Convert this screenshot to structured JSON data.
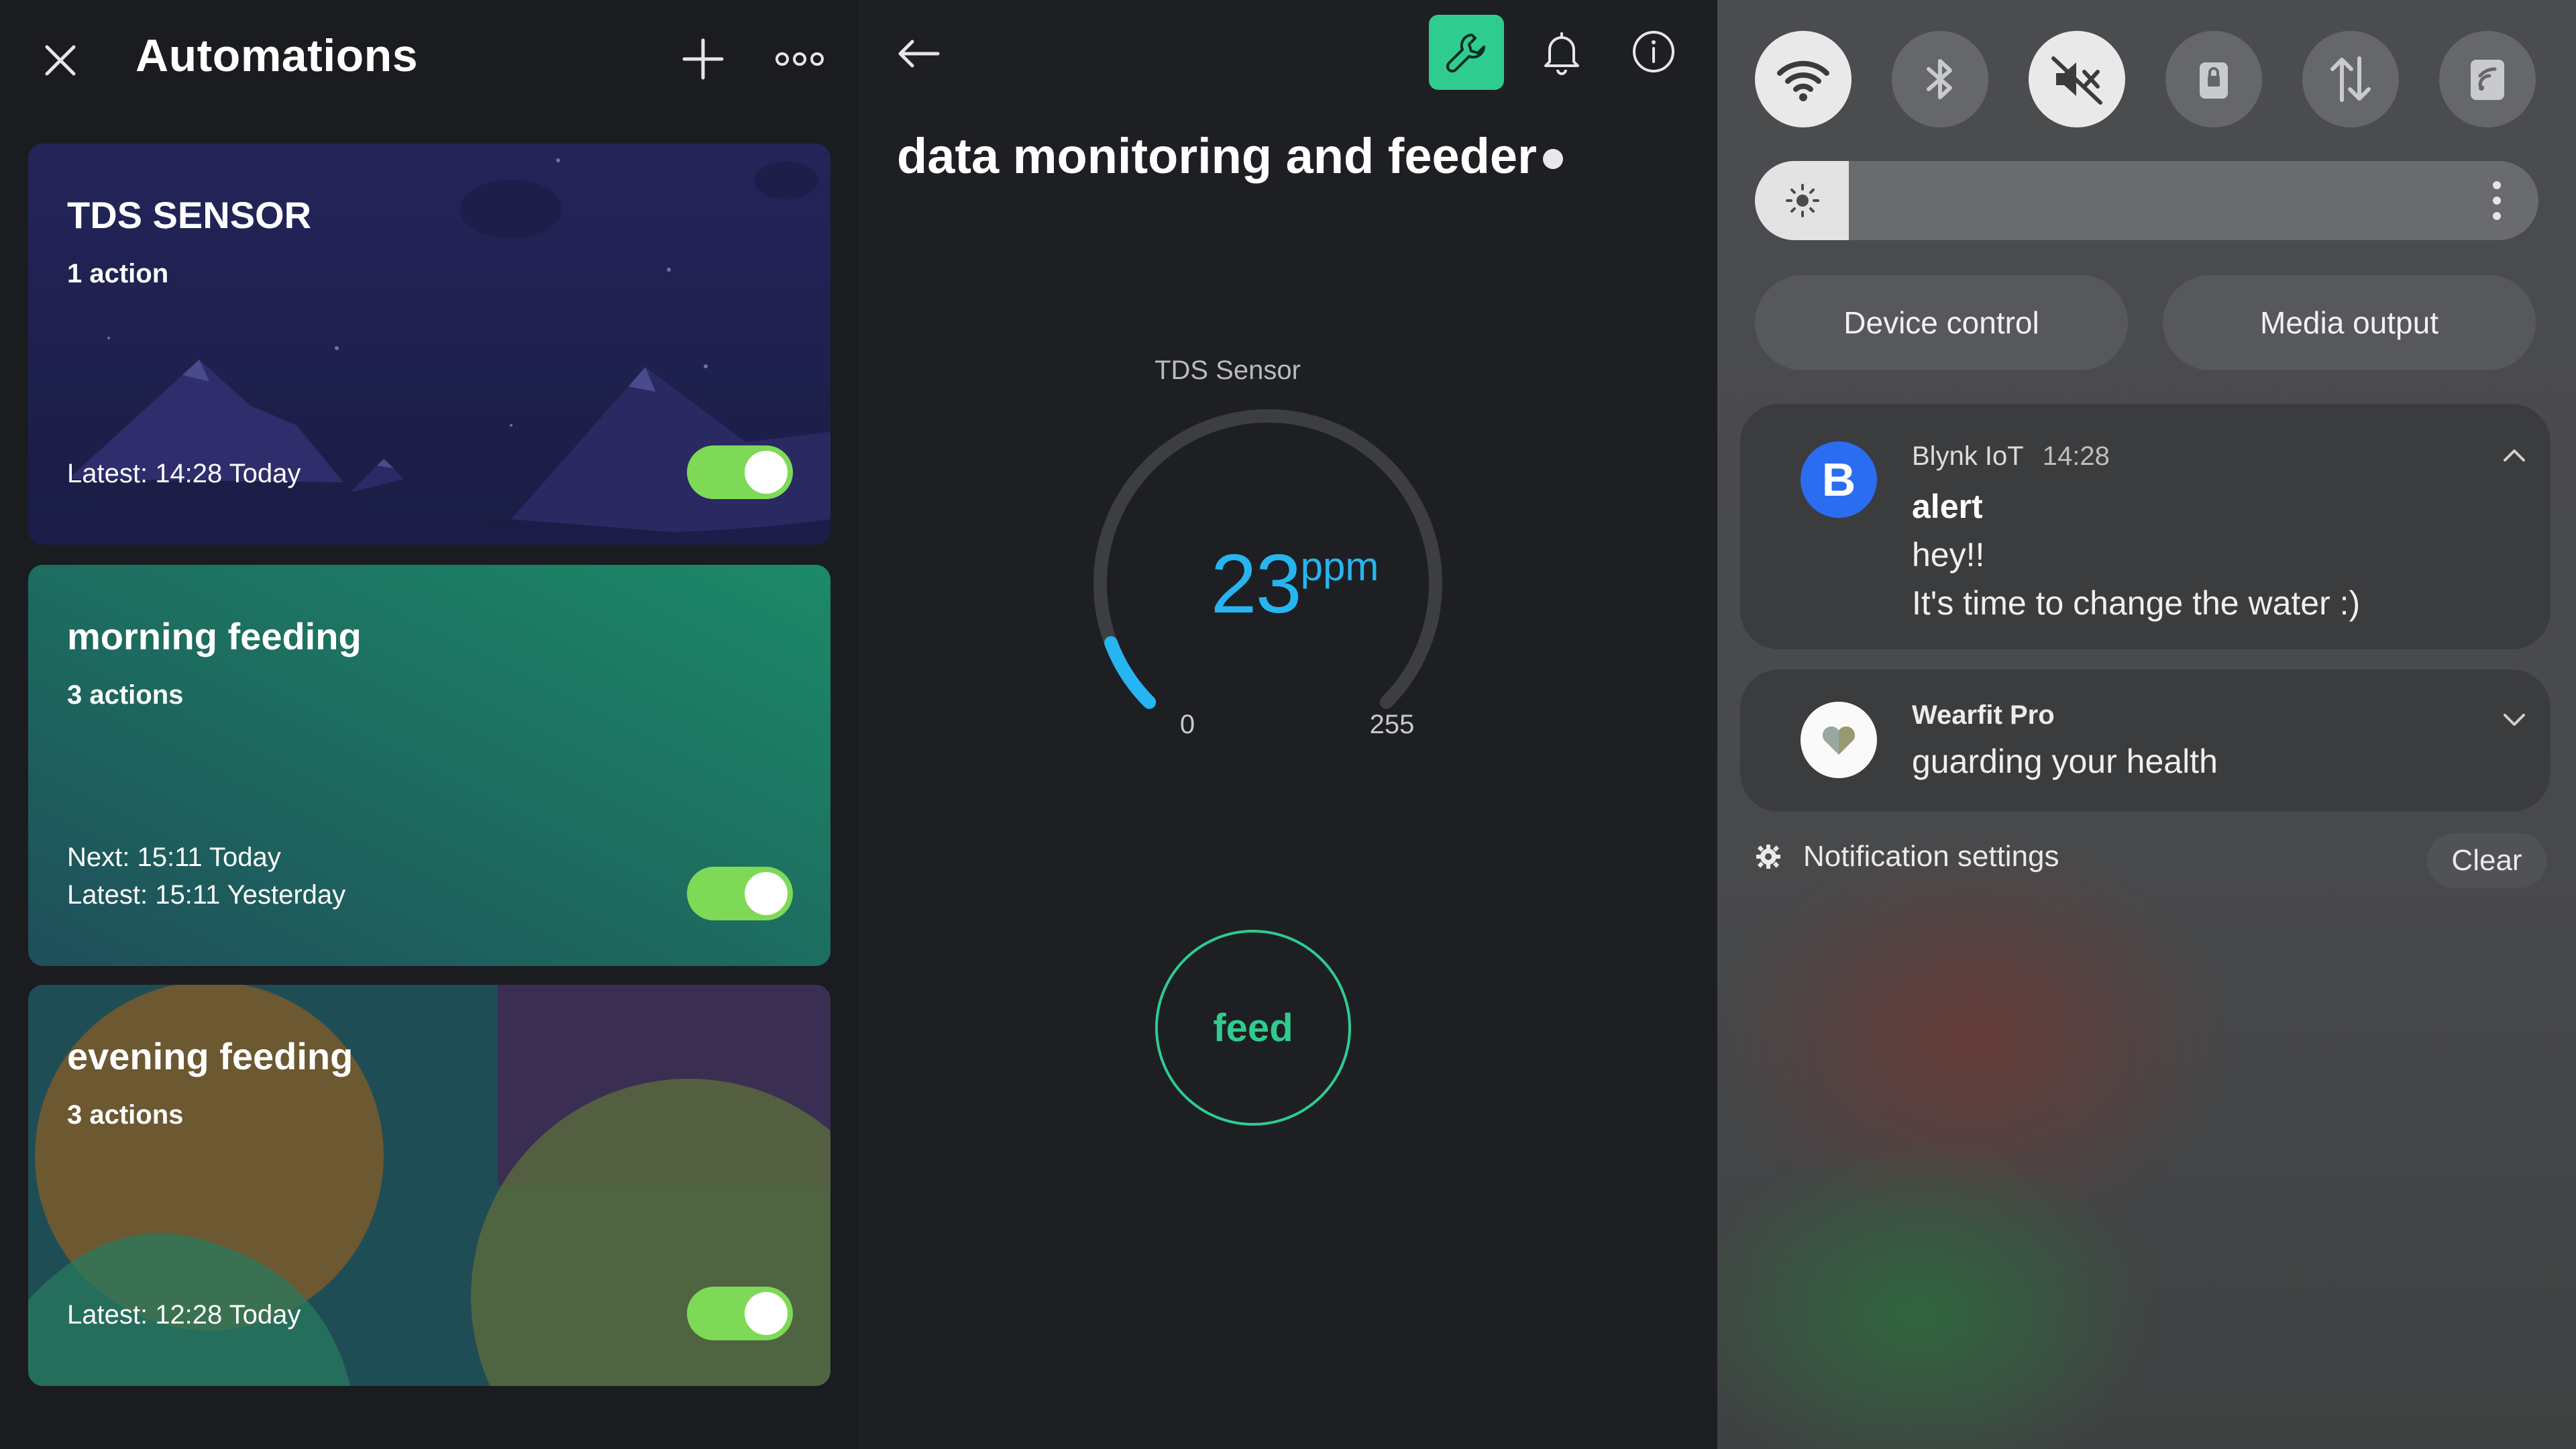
{
  "automations": {
    "title": "Automations",
    "cards": [
      {
        "title": "TDS SENSOR",
        "actions": "1 action",
        "times": [
          "Latest: 14:28 Today"
        ],
        "enabled": true
      },
      {
        "title": "morning feeding",
        "actions": "3 actions",
        "times": [
          "Next: 15:11 Today",
          "Latest: 15:11 Yesterday"
        ],
        "enabled": true
      },
      {
        "title": "evening feeding",
        "actions": "3 actions",
        "times": [
          "Latest: 12:28 Today"
        ],
        "enabled": true
      }
    ]
  },
  "device": {
    "title": "data monitoring and feeder",
    "gauge": {
      "label": "TDS Sensor",
      "value": "23",
      "unit": "ppm",
      "min": "0",
      "max": "255",
      "fraction": 0.09
    },
    "feed_label": "feed",
    "accent": "#2ecc8f",
    "gauge_color": "#26b5f0"
  },
  "quick_settings": {
    "toggles": [
      {
        "icon": "wifi-icon",
        "state": "on"
      },
      {
        "icon": "bluetooth-icon",
        "state": "off"
      },
      {
        "icon": "mute-icon",
        "state": "on"
      },
      {
        "icon": "rotation-lock-icon",
        "state": "off"
      },
      {
        "icon": "mobile-data-icon",
        "state": "off"
      },
      {
        "icon": "nfc-icon",
        "state": "off"
      }
    ],
    "brightness_fraction": 0.12,
    "device_control": "Device control",
    "media_output": "Media output",
    "notifications": [
      {
        "app": "Blynk IoT",
        "time": "14:28",
        "title": "alert",
        "lines": [
          "hey!!",
          "It's time to change the water :)"
        ],
        "icon": "blynk-b-icon",
        "icon_letter": "B"
      },
      {
        "app": "Wearfit Pro",
        "text": "guarding your health",
        "icon": "heart-icon"
      }
    ],
    "notification_settings": "Notification settings",
    "clear": "Clear"
  }
}
